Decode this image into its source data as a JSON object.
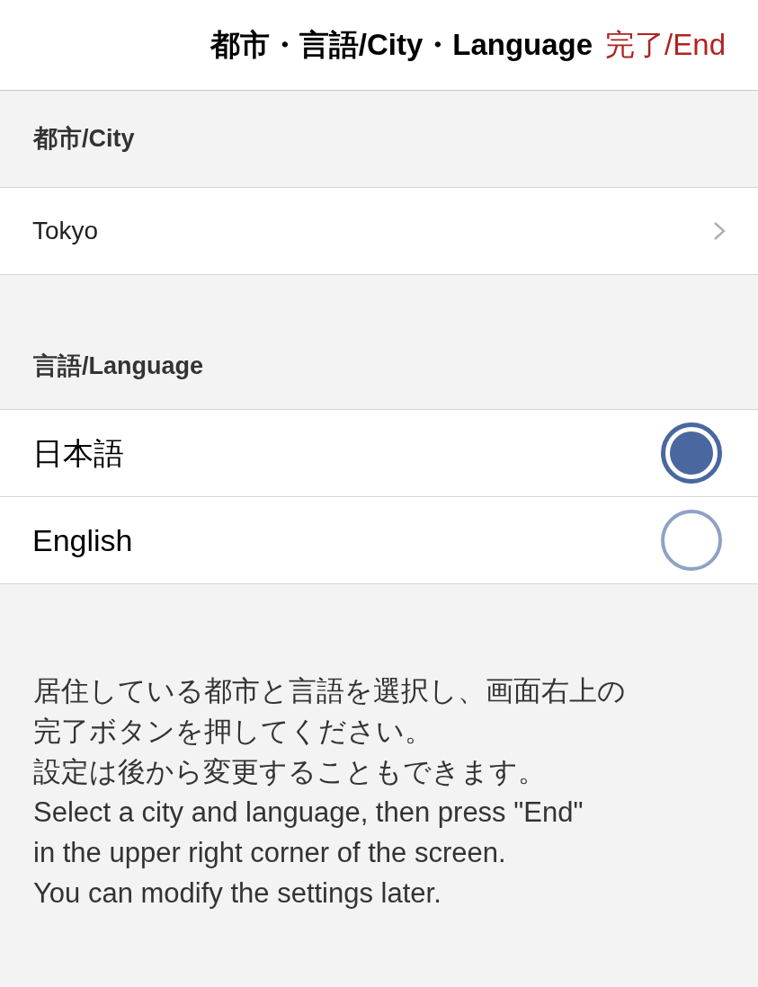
{
  "header": {
    "title": "都市・言語/City・Language",
    "done": "完了/End"
  },
  "city": {
    "heading": "都市/City",
    "value": "Tokyo"
  },
  "language": {
    "heading": "言語/Language",
    "options": [
      {
        "label": "日本語",
        "selected": true
      },
      {
        "label": "English",
        "selected": false
      }
    ]
  },
  "note": [
    "居住している都市と言語を選択し、画面右上の",
    "完了ボタンを押してください。",
    "設定は後から変更することもできます。",
    "Select a city and language, then press \"End\"",
    "in the upper right corner of the screen.",
    "You can modify the settings later."
  ]
}
